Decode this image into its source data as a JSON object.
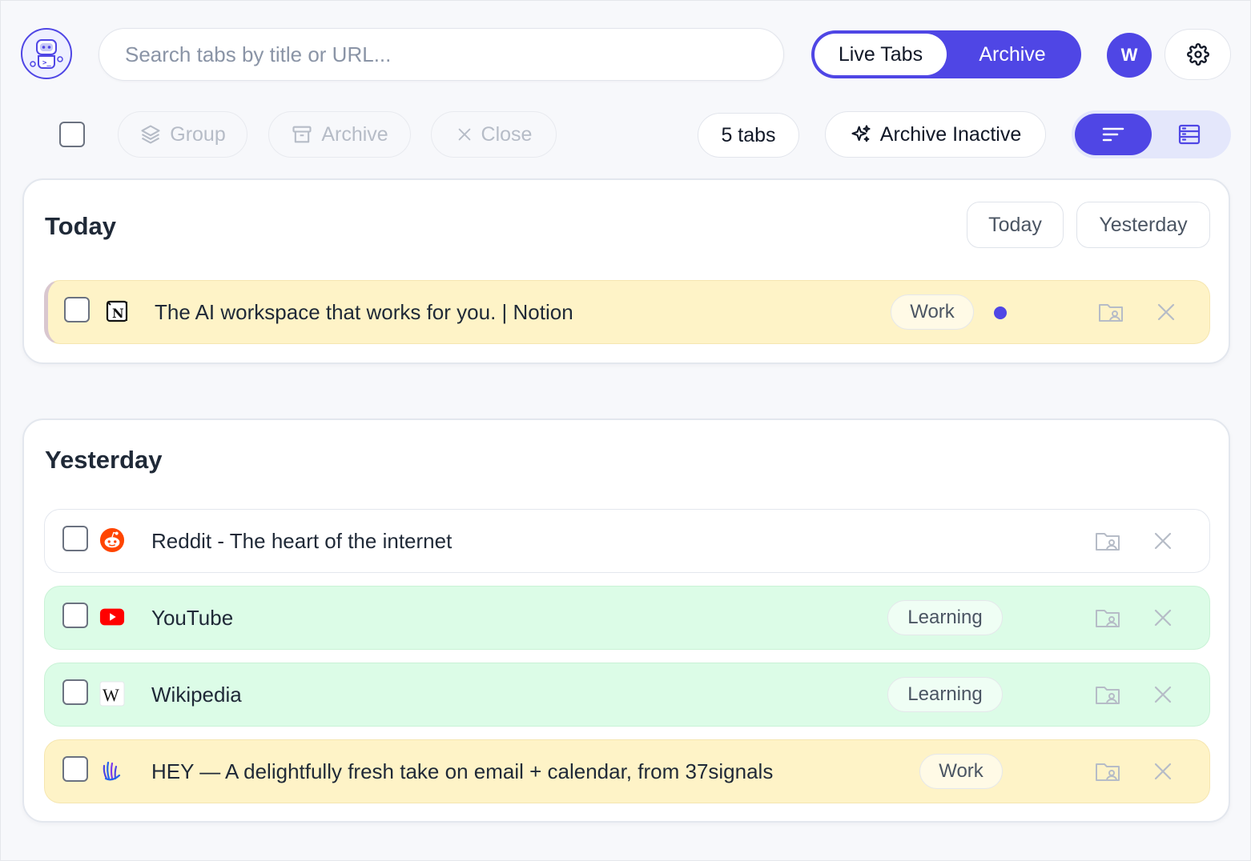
{
  "header": {
    "logo_icon": "robot-icon",
    "search_placeholder": "Search tabs by title or URL...",
    "view_toggle": {
      "active": "Live Tabs",
      "inactive": "Archive"
    },
    "avatar_initial": "W",
    "settings_icon": "gear-icon"
  },
  "toolbar": {
    "group_label": "Group",
    "archive_label": "Archive",
    "close_label": "Close",
    "tab_count": "5 tabs",
    "archive_inactive_label": "Archive Inactive",
    "layout_icons": [
      "sort-lines-icon",
      "list-view-icon"
    ]
  },
  "sections": [
    {
      "title": "Today",
      "filter_chips": [
        "Today",
        "Yesterday"
      ],
      "rows": [
        {
          "title": "The AI workspace that works for you. | Notion",
          "tag": "Work",
          "favicon": "notion-icon",
          "color": "#fef3c7",
          "active_dot": true
        }
      ]
    },
    {
      "title": "Yesterday",
      "rows": [
        {
          "title": "Reddit - The heart of the internet",
          "tag": "",
          "favicon": "reddit-icon",
          "color": "#ffffff"
        },
        {
          "title": "YouTube",
          "tag": "Learning",
          "favicon": "youtube-icon",
          "color": "#dcfce7"
        },
        {
          "title": "Wikipedia",
          "tag": "Learning",
          "favicon": "wikipedia-icon",
          "color": "#dcfce7"
        },
        {
          "title": "HEY — A delightfully fresh take on email + calendar, from 37signals",
          "tag": "Work",
          "favicon": "hey-icon",
          "color": "#fef3c7"
        }
      ]
    }
  ],
  "colors": {
    "accent": "#4f46e5",
    "work_row": "#fef3c7",
    "learning_row": "#dcfce7"
  }
}
